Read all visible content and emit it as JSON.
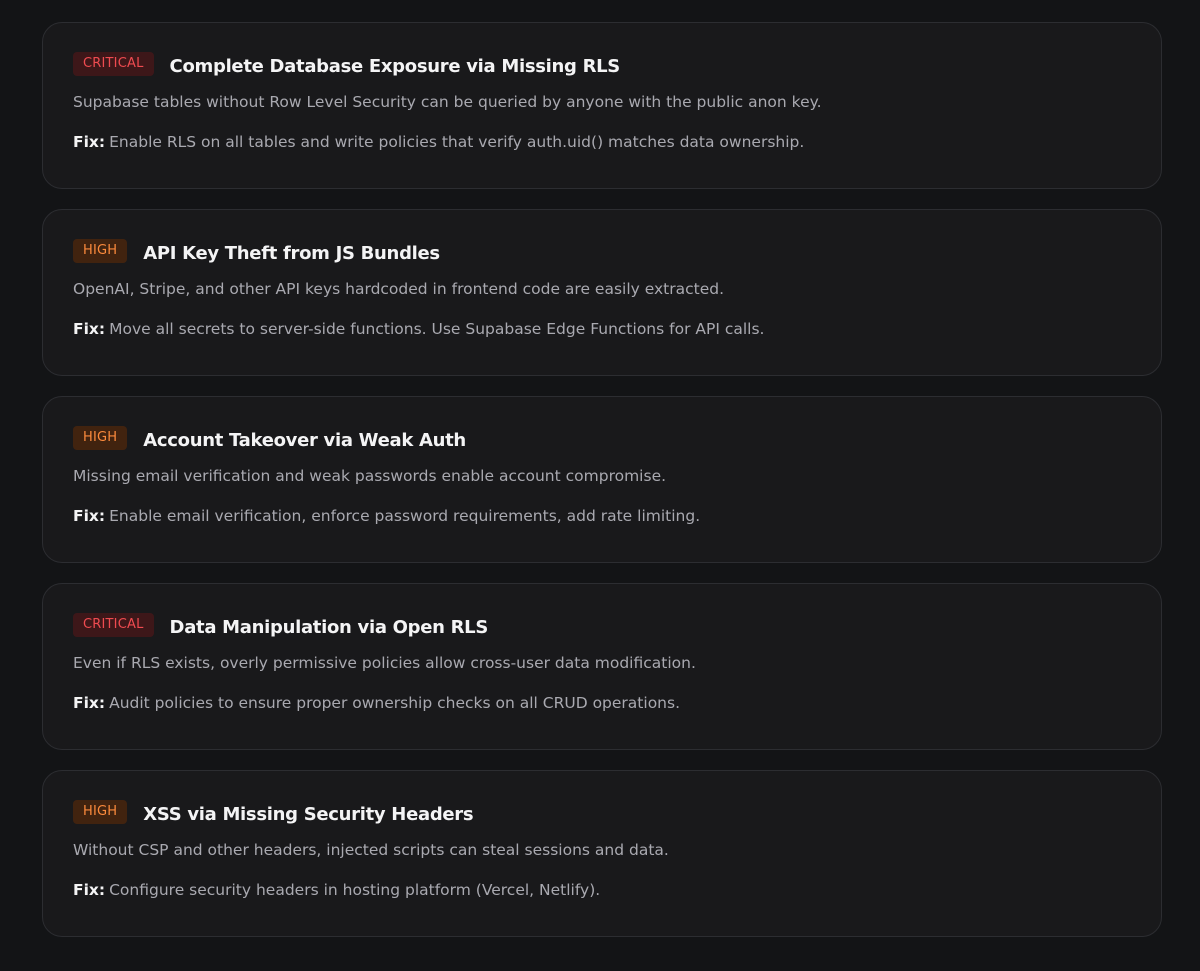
{
  "colors": {
    "background": "#131416",
    "card_background": "#19191b",
    "card_border": "#2c2d31",
    "critical_text": "#ef4b50",
    "critical_bg": "#3d1719",
    "high_text": "#fb8a3c",
    "high_bg": "#41230f"
  },
  "fix_label": "Fix:",
  "items": [
    {
      "severity": "critical",
      "badge": "CRITICAL",
      "title": "Complete Database Exposure via Missing RLS",
      "description": "Supabase tables without Row Level Security can be queried by anyone with the public anon key.",
      "fix": "Enable RLS on all tables and write policies that verify auth.uid() matches data ownership."
    },
    {
      "severity": "high",
      "badge": "HIGH",
      "title": "API Key Theft from JS Bundles",
      "description": "OpenAI, Stripe, and other API keys hardcoded in frontend code are easily extracted.",
      "fix": "Move all secrets to server-side functions. Use Supabase Edge Functions for API calls."
    },
    {
      "severity": "high",
      "badge": "HIGH",
      "title": "Account Takeover via Weak Auth",
      "description": "Missing email verification and weak passwords enable account compromise.",
      "fix": "Enable email verification, enforce password requirements, add rate limiting."
    },
    {
      "severity": "critical",
      "badge": "CRITICAL",
      "title": "Data Manipulation via Open RLS",
      "description": "Even if RLS exists, overly permissive policies allow cross-user data modification.",
      "fix": "Audit policies to ensure proper ownership checks on all CRUD operations."
    },
    {
      "severity": "high",
      "badge": "HIGH",
      "title": "XSS via Missing Security Headers",
      "description": "Without CSP and other headers, injected scripts can steal sessions and data.",
      "fix": "Configure security headers in hosting platform (Vercel, Netlify)."
    }
  ]
}
